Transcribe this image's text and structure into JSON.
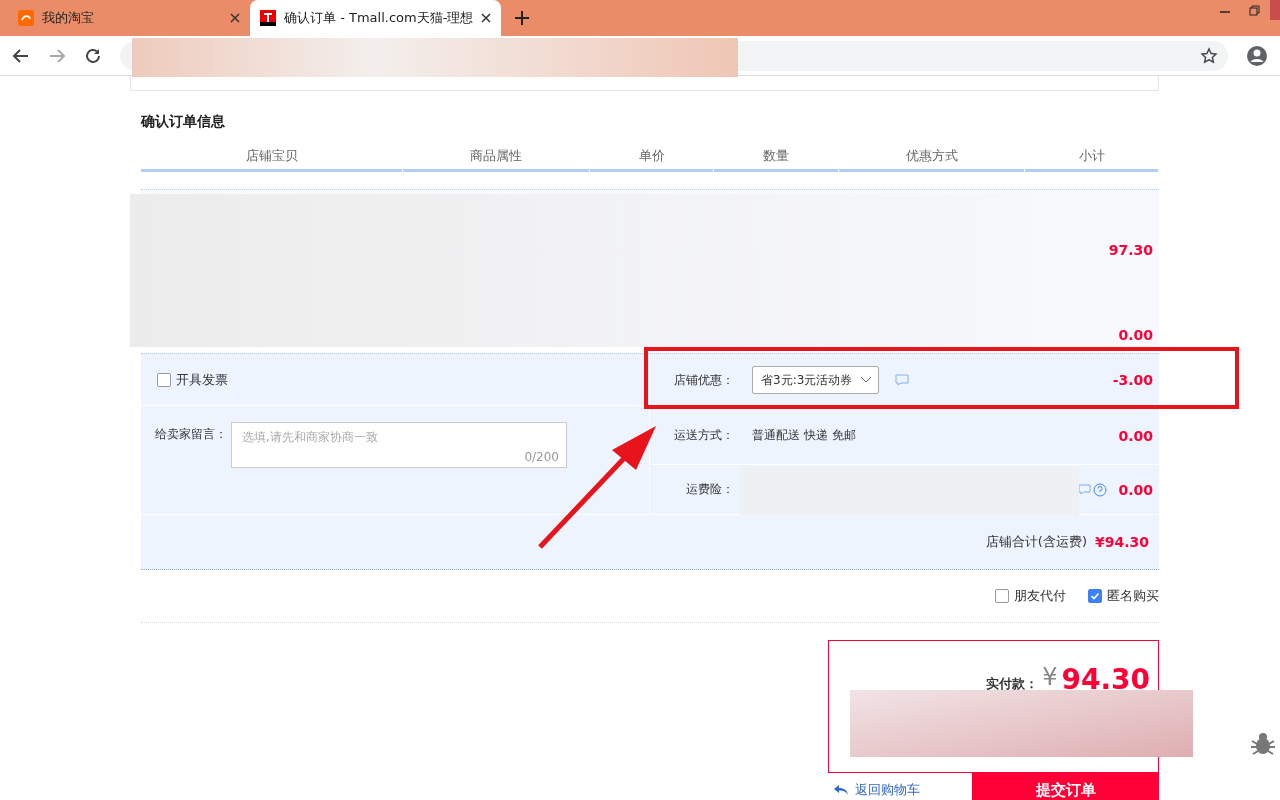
{
  "browser": {
    "tabs": [
      {
        "title": "我的淘宝",
        "selected": false
      },
      {
        "title": "确认订单 - Tmall.com天猫-理想",
        "selected": true
      }
    ]
  },
  "order": {
    "heading": "确认订单信息",
    "columns": [
      "店铺宝贝",
      "商品属性",
      "单价",
      "数量",
      "优惠方式",
      "小计"
    ],
    "subtotals": [
      "97.30",
      "0.00"
    ],
    "invoice": {
      "label": "开具发票",
      "checked": false
    },
    "message": {
      "label": "给卖家留言：",
      "placeholder": "选填,请先和商家协商一致",
      "counter": "0/200"
    },
    "shop_discount": {
      "label": "店铺优惠：",
      "value": "省3元:3元活动券",
      "amount": "-3.00"
    },
    "shipping": {
      "label": "运送方式：",
      "value": "普通配送 快递 免邮",
      "amount": "0.00"
    },
    "insurance": {
      "label": "运费险：",
      "amount": "0.00"
    },
    "shop_total": {
      "label": "店铺合计(含运费)",
      "amount": "¥94.30"
    }
  },
  "options": [
    {
      "label": "朋友代付",
      "checked": false
    },
    {
      "label": "匿名购买",
      "checked": true
    }
  ],
  "payment": {
    "label": "实付款：",
    "currency": "¥",
    "amount": "94.30"
  },
  "back_link": "返回购物车",
  "submit": "提交订单"
}
